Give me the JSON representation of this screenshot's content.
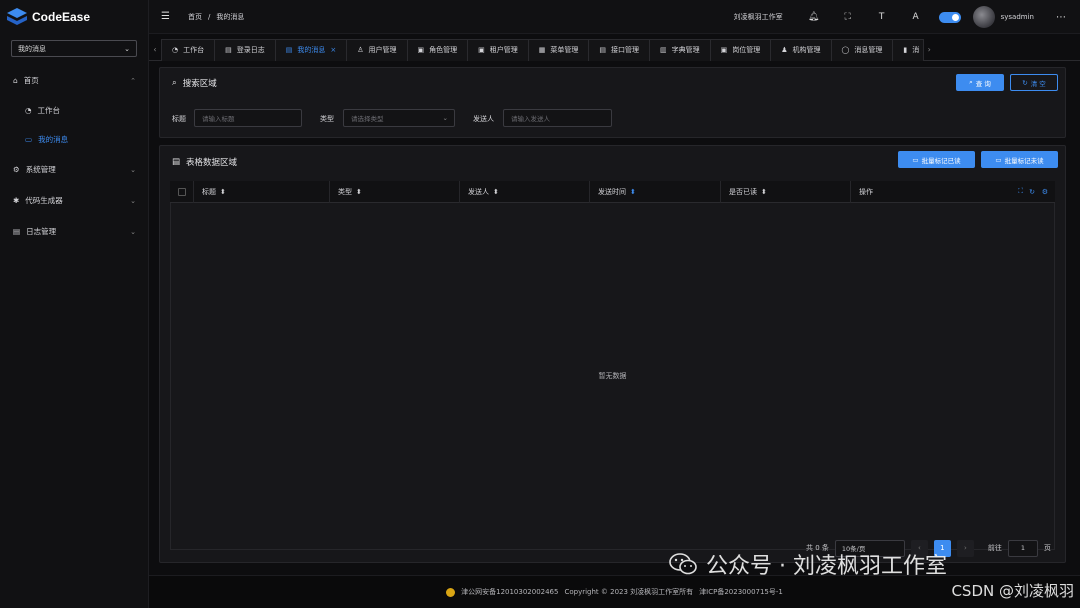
{
  "app": {
    "name": "CodeEase"
  },
  "sidebar": {
    "menu_select": "我的消息",
    "items": [
      {
        "label": "首页",
        "icon": "home-icon",
        "expanded": true
      },
      {
        "label": "工作台",
        "icon": "dashboard-icon",
        "sub": true
      },
      {
        "label": "我的消息",
        "icon": "message-icon",
        "sub": true,
        "active": true
      },
      {
        "label": "系统管理",
        "icon": "gear-icon"
      },
      {
        "label": "代码生成器",
        "icon": "gear-icon"
      },
      {
        "label": "日志管理",
        "icon": "document-icon"
      }
    ]
  },
  "header": {
    "breadcrumb": [
      "首页",
      "我的消息"
    ],
    "studio": "刘凌枫羽工作室",
    "username": "sysadmin"
  },
  "tabs": [
    {
      "label": "工作台",
      "icon": "dashboard-icon"
    },
    {
      "label": "登录日志",
      "icon": "document-icon"
    },
    {
      "label": "我的消息",
      "icon": "document-icon",
      "active": true,
      "close": "×"
    },
    {
      "label": "用户管理",
      "icon": "user-icon"
    },
    {
      "label": "角色管理",
      "icon": "role-icon"
    },
    {
      "label": "租户管理",
      "icon": "tenant-icon"
    },
    {
      "label": "菜单管理",
      "icon": "grid-icon"
    },
    {
      "label": "接口管理",
      "icon": "document-icon"
    },
    {
      "label": "字典管理",
      "icon": "book-icon"
    },
    {
      "label": "岗位管理",
      "icon": "tenant-icon"
    },
    {
      "label": "机构管理",
      "icon": "user-icon"
    },
    {
      "label": "消息管理",
      "icon": "chat-icon"
    },
    {
      "label": "消",
      "icon": "trash-icon"
    }
  ],
  "search": {
    "title": "搜索区域",
    "query_btn": "查 询",
    "reset_btn": "清 空",
    "fields": [
      {
        "label": "标题",
        "placeholder": "请输入标题"
      },
      {
        "label": "类型",
        "placeholder": "请选择类型"
      },
      {
        "label": "发送人",
        "placeholder": "请输入发送人"
      }
    ]
  },
  "table": {
    "title": "表格数据区域",
    "mark_read": "批量标记已读",
    "mark_unread": "批量标记未读",
    "columns": [
      "标题",
      "类型",
      "发送人",
      "发送时间",
      "是否已读",
      "操作"
    ],
    "empty": "暂无数据"
  },
  "pagination": {
    "total": "共 0 条",
    "page_size": "10条/页",
    "current": "1",
    "goto_label": "前往",
    "goto_value": "1",
    "page_unit": "页"
  },
  "footer": {
    "police": "津公网安备12010302002465",
    "copyright": "Copyright © 2023 刘凌枫羽工作室所有",
    "icp": "津ICP备2023000715号-1"
  },
  "watermark": {
    "text": "公众号 · 刘凌枫羽工作室",
    "csdn": "CSDN @刘凌枫羽"
  },
  "colors": {
    "accent": "#3d8cf0",
    "bg": "#0d0d0f",
    "panel": "#17171a"
  }
}
